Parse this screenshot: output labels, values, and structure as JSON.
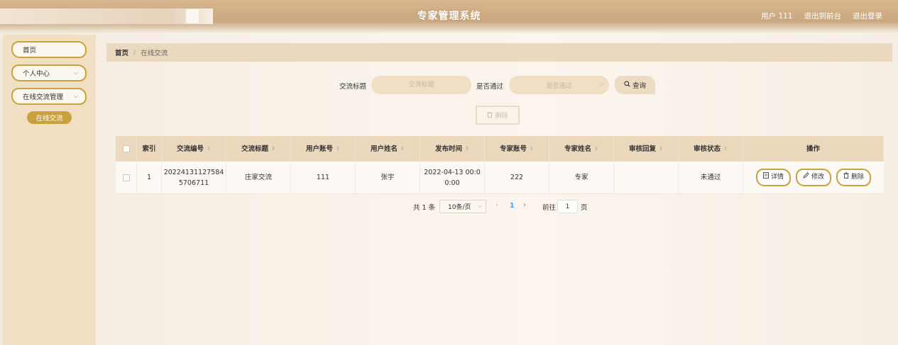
{
  "header": {
    "title": "专家管理系统",
    "user": "用户 111",
    "front_link": "退出到前台",
    "logout": "退出登录"
  },
  "sidebar": {
    "items": [
      {
        "label": "首页"
      },
      {
        "label": "个人中心"
      },
      {
        "label": "在线交流管理"
      }
    ],
    "sub_item": "在线交流"
  },
  "breadcrumb": {
    "home": "首页",
    "separator": "/",
    "current": "在线交流"
  },
  "search": {
    "title_label": "交流标题",
    "title_placeholder": "交流标题",
    "pass_label": "是否通过",
    "pass_placeholder": "是否通过",
    "query_label": "查询"
  },
  "toolbar": {
    "delete_label": "删除"
  },
  "table": {
    "headers": [
      "索引",
      "交流编号",
      "交流标题",
      "用户账号",
      "用户姓名",
      "发布时间",
      "专家账号",
      "专家姓名",
      "审核回复",
      "审核状态",
      "操作"
    ],
    "rows": [
      {
        "index": "1",
        "code": "20224131127584 5706711",
        "title": "庄家交流",
        "user_account": "111",
        "user_name": "张宇",
        "publish_time": "2022-04-13 00:0 0:00",
        "expert_account": "222",
        "expert_name": "专家",
        "audit_reply": "",
        "audit_status": "未通过"
      }
    ],
    "actions": {
      "detail": "详情",
      "edit": "修改",
      "delete": "删除"
    }
  },
  "pagination": {
    "total": "共 1 条",
    "page_size": "10条/页",
    "current_page": "1",
    "goto_label": "前往",
    "goto_value": "1",
    "page_suffix": "页"
  },
  "colors": {
    "accent_gold": "#c9a13d",
    "header_tan": "#d8b68e",
    "table_header": "#ecd9bd",
    "page_link": "#409eff"
  }
}
